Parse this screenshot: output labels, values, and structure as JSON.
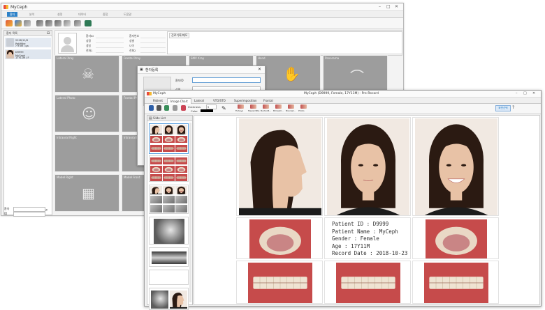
{
  "back_window": {
    "app_title": "MyCeph",
    "tabs": [
      "환자",
      "분석",
      "설정",
      "데이터",
      "중첩",
      "도움말"
    ],
    "panel_title": "환자 목록",
    "patients": [
      {
        "line1": "2018/11/8",
        "line2": "PatiMike",
        "line3": "??F3M / ga"
      },
      {
        "line1": "D9999",
        "line2": "MyCeph",
        "line3": "17Y11M / F"
      }
    ],
    "search_label": "환자",
    "search_label2": "ID",
    "info_labels": [
      "환자ID",
      "성명",
      "생일",
      "전화1",
      "환자번호",
      "성별",
      "나이",
      "전화2"
    ],
    "diag_tab": "진료기록/메모",
    "grid_labels": [
      "Lateral Xray",
      "Frontal Xray",
      "SMV Xray",
      "Hand",
      "Panorama",
      "Lateral Photo",
      "Frontal Photo",
      "",
      "",
      "",
      "Intraoral Right",
      "Intraoral Front",
      "",
      "",
      "",
      "Model Right",
      "Model Front",
      "",
      "",
      ""
    ]
  },
  "dialog": {
    "title": "환자등록",
    "field1_label": "환자ID",
    "field2_label": "성명"
  },
  "front_window": {
    "app_title": "MyCeph",
    "title_center": "MyCeph (D9999, Female, 17Y11M) - Pre-Record",
    "tabs": [
      "Patient",
      "Image Chart",
      "Lateral",
      "VTO/STO",
      "Superimposition",
      "Frontal"
    ],
    "toolbar": {
      "thickness_label": "thickness",
      "thickness_value": "5",
      "color_label": "Color",
      "tools": [
        "Fisheye",
        "Mesial Bite",
        "BurtonB...",
        "Bimaxill...",
        "Bracket...",
        "Photo"
      ]
    },
    "top_right_button": "화면선택",
    "slide_list_title": "Slide List",
    "record_info": [
      "Patient ID : D9999",
      "Patient Name : MyCeph",
      "Gender : Female",
      "Age : 17Y11M",
      "Record Date : 2018-10-23"
    ]
  },
  "colors": {
    "accent": "#2e82c8",
    "grid_gray": "#9d9d9d",
    "hair": "#2b1a12",
    "skin": "#e8c2a6"
  }
}
